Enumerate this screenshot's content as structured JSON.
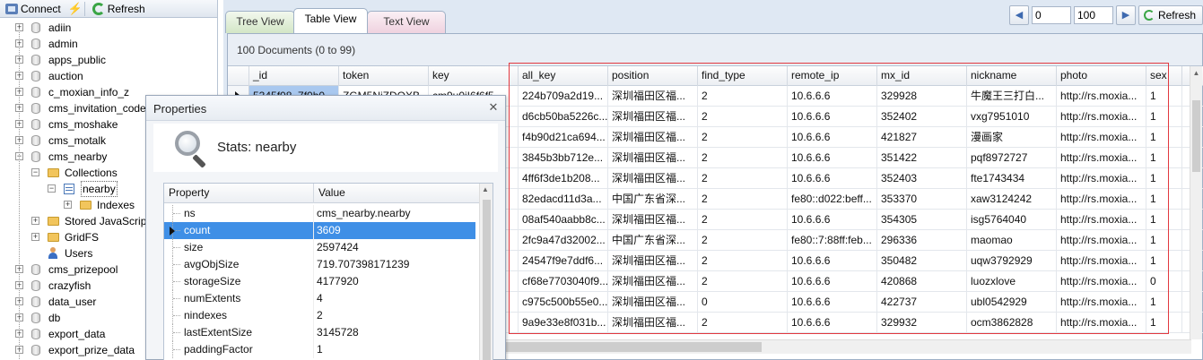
{
  "toolbar": {
    "connect_label": "Connect",
    "refresh_label": "Refresh"
  },
  "tree": {
    "items": [
      {
        "label": "adiin",
        "type": "db"
      },
      {
        "label": "admin",
        "type": "db"
      },
      {
        "label": "apps_public",
        "type": "db"
      },
      {
        "label": "auction",
        "type": "db"
      },
      {
        "label": "c_moxian_info_z",
        "type": "db"
      },
      {
        "label": "cms_invitation_code",
        "type": "db"
      },
      {
        "label": "cms_moshake",
        "type": "db"
      },
      {
        "label": "cms_motalk",
        "type": "db"
      },
      {
        "label": "cms_nearby",
        "type": "db"
      },
      {
        "label": "Collections",
        "type": "folder"
      },
      {
        "label": "nearby",
        "type": "collection"
      },
      {
        "label": "Indexes",
        "type": "folder"
      },
      {
        "label": "Stored JavaScript",
        "type": "folder"
      },
      {
        "label": "GridFS",
        "type": "folder"
      },
      {
        "label": "Users",
        "type": "user"
      },
      {
        "label": "cms_prizepool",
        "type": "db"
      },
      {
        "label": "crazyfish",
        "type": "db"
      },
      {
        "label": "data_user",
        "type": "db"
      },
      {
        "label": "db",
        "type": "db"
      },
      {
        "label": "export_data",
        "type": "db"
      },
      {
        "label": "export_prize_data",
        "type": "db"
      }
    ]
  },
  "tabs": {
    "tree_view": "Tree View",
    "table_view": "Table View",
    "text_view": "Text View"
  },
  "pager": {
    "skip_value": "0",
    "limit_value": "100",
    "refresh_label": "Refresh"
  },
  "doc_count": "100 Documents (0 to 99)",
  "grid": {
    "columns": [
      "_id",
      "token",
      "key",
      "all_key",
      "position",
      "find_type",
      "remote_ip",
      "mx_id",
      "nickname",
      "photo",
      "sex"
    ],
    "rows": [
      [
        "5345f08..7f0b0",
        "ZGM5NjZDQXB",
        "cm9u0iI6f6f5",
        "224b709a2d19...",
        "深圳福田区福...",
        "2",
        "10.6.6.6",
        "329928",
        "牛魔王三打白...",
        "http://rs.moxia...",
        "1"
      ],
      [
        "",
        "",
        "",
        "d6cb50ba5226c...",
        "深圳福田区福...",
        "2",
        "10.6.6.6",
        "352402",
        "vxg7951010",
        "http://rs.moxia...",
        "1"
      ],
      [
        "",
        "",
        "",
        "f4b90d21ca694...",
        "深圳福田区福...",
        "2",
        "10.6.6.6",
        "421827",
        "漫画家",
        "http://rs.moxia...",
        "1"
      ],
      [
        "",
        "",
        "",
        "3845b3bb712e...",
        "深圳福田区福...",
        "2",
        "10.6.6.6",
        "351422",
        "pqf8972727",
        "http://rs.moxia...",
        "1"
      ],
      [
        "",
        "",
        "",
        "4ff6f3de1b208...",
        "深圳福田区福...",
        "2",
        "10.6.6.6",
        "352403",
        "fte1743434",
        "http://rs.moxia...",
        "1"
      ],
      [
        "",
        "",
        "",
        "82edacd11d3a...",
        "中国广东省深...",
        "2",
        "fe80::d022:beff...",
        "353370",
        "xaw3124242",
        "http://rs.moxia...",
        "1"
      ],
      [
        "",
        "",
        "",
        "08af540aabb8c...",
        "深圳福田区福...",
        "2",
        "10.6.6.6",
        "354305",
        "isg5764040",
        "http://rs.moxia...",
        "1"
      ],
      [
        "",
        "",
        "",
        "2fc9a47d32002...",
        "中国广东省深...",
        "2",
        "fe80::7:88ff:feb...",
        "296336",
        "maomao",
        "http://rs.moxia...",
        "1"
      ],
      [
        "",
        "",
        "",
        "24547f9e7ddf6...",
        "深圳福田区福...",
        "2",
        "10.6.6.6",
        "350482",
        "uqw3792929",
        "http://rs.moxia...",
        "1"
      ],
      [
        "",
        "",
        "",
        "cf68e7703040f9...",
        "深圳福田区福...",
        "2",
        "10.6.6.6",
        "420868",
        "luozxlove",
        "http://rs.moxia...",
        "0"
      ],
      [
        "",
        "",
        "",
        "c975c500b55e0...",
        "深圳福田区福...",
        "0",
        "10.6.6.6",
        "422737",
        "ubl0542929",
        "http://rs.moxia...",
        "1"
      ],
      [
        "",
        "",
        "",
        "9a9e33e8f031b...",
        "深圳福田区福...",
        "2",
        "10.6.6.6",
        "329932",
        "ocm3862828",
        "http://rs.moxia...",
        "1"
      ]
    ]
  },
  "properties": {
    "title": "Properties",
    "header": "Stats: nearby",
    "col_property": "Property",
    "col_value": "Value",
    "rows": [
      {
        "key": "ns",
        "value": "cms_nearby.nearby"
      },
      {
        "key": "count",
        "value": "3609"
      },
      {
        "key": "size",
        "value": "2597424"
      },
      {
        "key": "avgObjSize",
        "value": "719.707398171239"
      },
      {
        "key": "storageSize",
        "value": "4177920"
      },
      {
        "key": "numExtents",
        "value": "4"
      },
      {
        "key": "nindexes",
        "value": "2"
      },
      {
        "key": "lastExtentSize",
        "value": "3145728"
      },
      {
        "key": "paddingFactor",
        "value": "1"
      }
    ]
  },
  "colors": {
    "selection": "#3f8fe6",
    "annotation": "#e2383f",
    "panel_bg": "#dfe8f3"
  }
}
